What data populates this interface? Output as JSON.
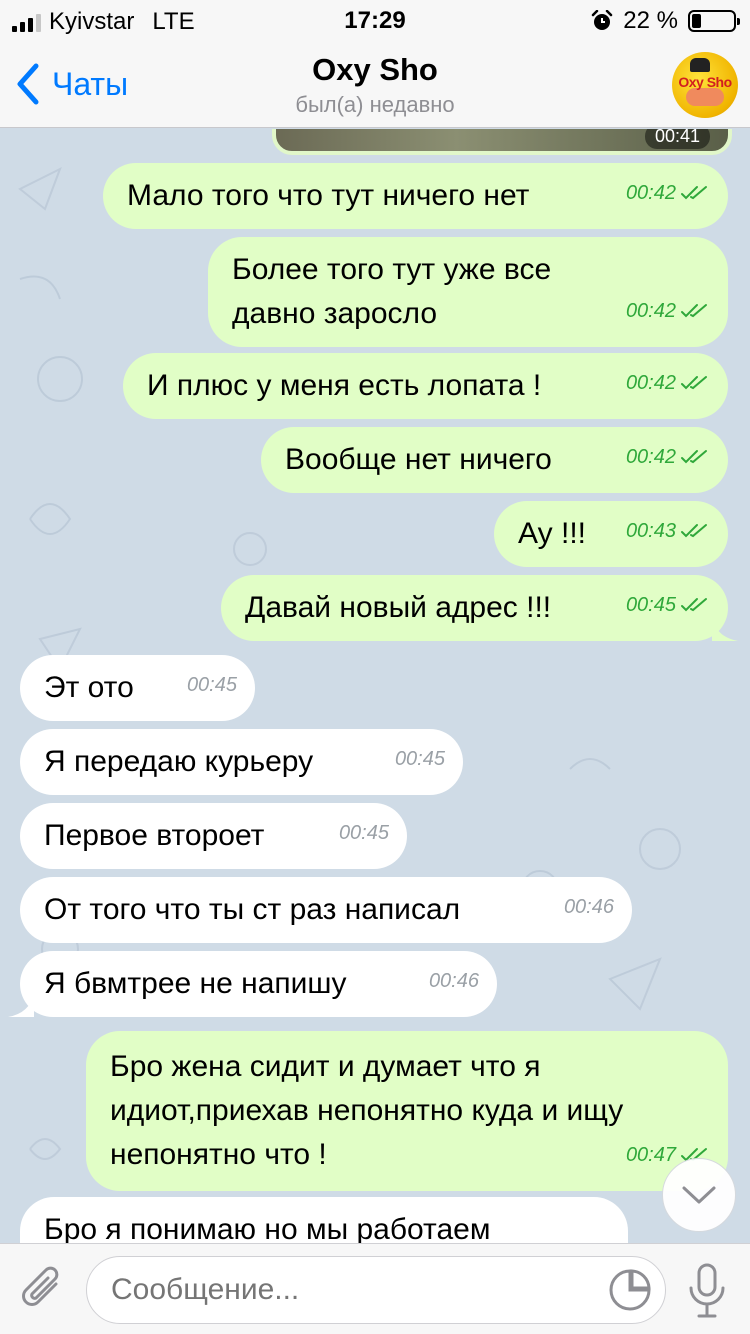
{
  "status": {
    "carrier": "Kyivstar",
    "network": "LTE",
    "time": "17:29",
    "battery_text": "22 %",
    "battery_level": 0.22
  },
  "nav": {
    "back_label": "Чаты",
    "title": "Oxy Sho",
    "subtitle": "был(а) недавно",
    "avatar_logo": "Oxy Sho"
  },
  "photo_stub_time": "00:41",
  "messages": [
    {
      "dir": "out",
      "text": "Мало того что тут ничего нет",
      "time": "00:42"
    },
    {
      "dir": "out",
      "text": "Более того тут уже все давно заросло",
      "time": "00:42"
    },
    {
      "dir": "out",
      "text": "И плюс у меня есть лопата !",
      "time": "00:42"
    },
    {
      "dir": "out",
      "text": "Вообще нет ничего",
      "time": "00:42"
    },
    {
      "dir": "out",
      "text": "Ау !!!",
      "time": "00:43"
    },
    {
      "dir": "out",
      "text": "Давай новый адрес !!!",
      "time": "00:45"
    },
    {
      "dir": "in",
      "text": "Эт ото",
      "time": "00:45"
    },
    {
      "dir": "in",
      "text": "Я передаю курьеру",
      "time": "00:45"
    },
    {
      "dir": "in",
      "text": "Первое второет",
      "time": "00:45"
    },
    {
      "dir": "in",
      "text": "От того что ты ст раз написал",
      "time": "00:46"
    },
    {
      "dir": "in",
      "text": "Я бвмтрее не напишу",
      "time": "00:46"
    },
    {
      "dir": "out",
      "text": "Бро жена сидит и думает что я идиот,приехав непонятно куда и ищу непонятно что !",
      "time": "00:47"
    },
    {
      "dir": "in",
      "text": "Бро я понимаю но мы работаем до",
      "time": ""
    }
  ],
  "input": {
    "placeholder": "Сообщение..."
  },
  "colors": {
    "accent": "#007aff",
    "outgoing_bubble": "#e1fec6",
    "incoming_bubble": "#ffffff",
    "read_check": "#2fa83a",
    "chat_background": "#cfdbe6"
  },
  "icons": {
    "back": "chevron-left-icon",
    "attach": "paperclip-icon",
    "sticker": "sticker-icon",
    "mic": "microphone-icon",
    "scroll": "chevron-down-icon"
  }
}
